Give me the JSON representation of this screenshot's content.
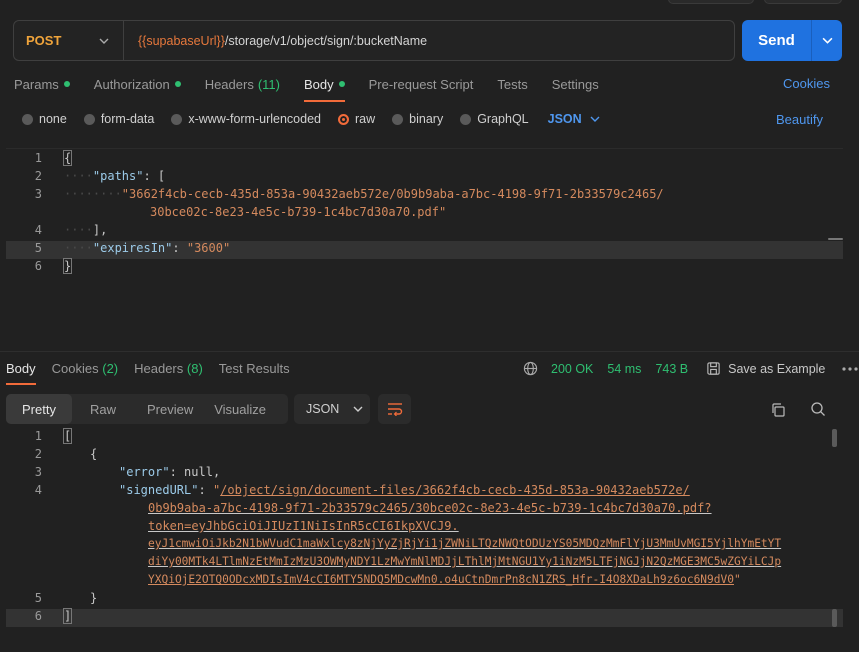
{
  "request": {
    "method": "POST",
    "url_var": "{{supabaseUrl}}",
    "url_path": "/storage/v1/object/sign/:bucketName",
    "send_label": "Send"
  },
  "tabs": [
    {
      "label": "Params",
      "dot": true
    },
    {
      "label": "Authorization",
      "dot": true
    },
    {
      "label": "Headers",
      "count": "(11)"
    },
    {
      "label": "Body",
      "dot": true,
      "active": true
    },
    {
      "label": "Pre-request Script"
    },
    {
      "label": "Tests"
    },
    {
      "label": "Settings"
    }
  ],
  "cookies_link": "Cookies",
  "body_types": {
    "none": "none",
    "form_data": "form-data",
    "urlencoded": "x-www-form-urlencoded",
    "raw": "raw",
    "binary": "binary",
    "graphql": "GraphQL",
    "json": "JSON",
    "beautify": "Beautify"
  },
  "request_body": {
    "line_numbers": [
      "1",
      "2",
      "3",
      "",
      "4",
      "5",
      "6"
    ],
    "lines": {
      "l1": "{",
      "l2_key": "\"paths\"",
      "l2_rest": ": [",
      "l3a": "\"3662f4cb-cecb-435d-853a-90432aeb572e/0b9b9aba-a7bc-4198-9f71-2b33579c2465/",
      "l3b": "30bce02c-8e23-4e5c-b739-1c4bc7d30a70.pdf\"",
      "l4": "],",
      "l5_key": "\"expiresIn\"",
      "l5_sep": ": ",
      "l5_val": "\"3600\"",
      "l6": "}"
    }
  },
  "response": {
    "tabs": {
      "body": "Body",
      "cookies": "Cookies",
      "cookies_count": "(2)",
      "headers": "Headers",
      "headers_count": "(8)",
      "tests": "Test Results"
    },
    "status": "200 OK",
    "time": "54 ms",
    "size": "743 B",
    "save_example": "Save as Example",
    "views": {
      "pretty": "Pretty",
      "raw": "Raw",
      "preview": "Preview",
      "visualize": "Visualize"
    },
    "format": "JSON",
    "line_numbers": {
      "n1": "1",
      "n2": "2",
      "n3": "3",
      "n4": "4",
      "n5": "5",
      "n6": "6"
    },
    "lines": {
      "l1": "[",
      "l2": "{",
      "l3_key": "\"error\"",
      "l3_sep": ": ",
      "l3_val": "null",
      "l3_end": ",",
      "l4_key": "\"signedURL\"",
      "l4_sep": ": ",
      "l4_q": "\"",
      "url1": "/object/sign/document-files/3662f4cb-cecb-435d-853a-90432aeb572e/",
      "url2": "0b9b9aba-a7bc-4198-9f71-2b33579c2465/30bce02c-8e23-4e5c-b739-1c4bc7d30a70.pdf?",
      "url3": "token=eyJhbGciOiJIUzI1NiIsInR5cCI6IkpXVCJ9.",
      "url4": "eyJ1cmwiOiJkb2N1bWVudC1maWxlcy8zNjYyZjRjYi1jZWNiLTQzNWQtODUzYS05MDQzMmFlYjU3MmUvMGI5YjlhYmEtYT",
      "url5": "diYy00MTk4LTlmNzEtMmIzMzU3OWMyNDY1LzMwYmNlMDJjLThlMjMtNGU1Yy1iNzM5LTFjNGJjN2QzMGE3MC5wZGYiLCJp",
      "url6": "YXQiOjE2OTQ0ODcxMDIsImV4cCI6MTY5NDQ5MDcwMn0.o4uCtnDmrPn8cN1ZRS_Hfr-I4O8XDaLh9z6oc6N9dV0",
      "l5": "}",
      "l6": "]"
    }
  }
}
